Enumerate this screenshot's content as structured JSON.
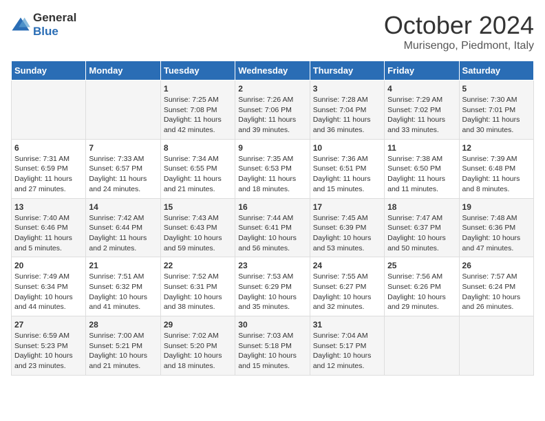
{
  "header": {
    "logo_general": "General",
    "logo_blue": "Blue",
    "title": "October 2024",
    "location": "Murisengo, Piedmont, Italy"
  },
  "days_of_week": [
    "Sunday",
    "Monday",
    "Tuesday",
    "Wednesday",
    "Thursday",
    "Friday",
    "Saturday"
  ],
  "weeks": [
    [
      {
        "day": "",
        "content": ""
      },
      {
        "day": "",
        "content": ""
      },
      {
        "day": "1",
        "content": "Sunrise: 7:25 AM\nSunset: 7:08 PM\nDaylight: 11 hours and 42 minutes."
      },
      {
        "day": "2",
        "content": "Sunrise: 7:26 AM\nSunset: 7:06 PM\nDaylight: 11 hours and 39 minutes."
      },
      {
        "day": "3",
        "content": "Sunrise: 7:28 AM\nSunset: 7:04 PM\nDaylight: 11 hours and 36 minutes."
      },
      {
        "day": "4",
        "content": "Sunrise: 7:29 AM\nSunset: 7:02 PM\nDaylight: 11 hours and 33 minutes."
      },
      {
        "day": "5",
        "content": "Sunrise: 7:30 AM\nSunset: 7:01 PM\nDaylight: 11 hours and 30 minutes."
      }
    ],
    [
      {
        "day": "6",
        "content": "Sunrise: 7:31 AM\nSunset: 6:59 PM\nDaylight: 11 hours and 27 minutes."
      },
      {
        "day": "7",
        "content": "Sunrise: 7:33 AM\nSunset: 6:57 PM\nDaylight: 11 hours and 24 minutes."
      },
      {
        "day": "8",
        "content": "Sunrise: 7:34 AM\nSunset: 6:55 PM\nDaylight: 11 hours and 21 minutes."
      },
      {
        "day": "9",
        "content": "Sunrise: 7:35 AM\nSunset: 6:53 PM\nDaylight: 11 hours and 18 minutes."
      },
      {
        "day": "10",
        "content": "Sunrise: 7:36 AM\nSunset: 6:51 PM\nDaylight: 11 hours and 15 minutes."
      },
      {
        "day": "11",
        "content": "Sunrise: 7:38 AM\nSunset: 6:50 PM\nDaylight: 11 hours and 11 minutes."
      },
      {
        "day": "12",
        "content": "Sunrise: 7:39 AM\nSunset: 6:48 PM\nDaylight: 11 hours and 8 minutes."
      }
    ],
    [
      {
        "day": "13",
        "content": "Sunrise: 7:40 AM\nSunset: 6:46 PM\nDaylight: 11 hours and 5 minutes."
      },
      {
        "day": "14",
        "content": "Sunrise: 7:42 AM\nSunset: 6:44 PM\nDaylight: 11 hours and 2 minutes."
      },
      {
        "day": "15",
        "content": "Sunrise: 7:43 AM\nSunset: 6:43 PM\nDaylight: 10 hours and 59 minutes."
      },
      {
        "day": "16",
        "content": "Sunrise: 7:44 AM\nSunset: 6:41 PM\nDaylight: 10 hours and 56 minutes."
      },
      {
        "day": "17",
        "content": "Sunrise: 7:45 AM\nSunset: 6:39 PM\nDaylight: 10 hours and 53 minutes."
      },
      {
        "day": "18",
        "content": "Sunrise: 7:47 AM\nSunset: 6:37 PM\nDaylight: 10 hours and 50 minutes."
      },
      {
        "day": "19",
        "content": "Sunrise: 7:48 AM\nSunset: 6:36 PM\nDaylight: 10 hours and 47 minutes."
      }
    ],
    [
      {
        "day": "20",
        "content": "Sunrise: 7:49 AM\nSunset: 6:34 PM\nDaylight: 10 hours and 44 minutes."
      },
      {
        "day": "21",
        "content": "Sunrise: 7:51 AM\nSunset: 6:32 PM\nDaylight: 10 hours and 41 minutes."
      },
      {
        "day": "22",
        "content": "Sunrise: 7:52 AM\nSunset: 6:31 PM\nDaylight: 10 hours and 38 minutes."
      },
      {
        "day": "23",
        "content": "Sunrise: 7:53 AM\nSunset: 6:29 PM\nDaylight: 10 hours and 35 minutes."
      },
      {
        "day": "24",
        "content": "Sunrise: 7:55 AM\nSunset: 6:27 PM\nDaylight: 10 hours and 32 minutes."
      },
      {
        "day": "25",
        "content": "Sunrise: 7:56 AM\nSunset: 6:26 PM\nDaylight: 10 hours and 29 minutes."
      },
      {
        "day": "26",
        "content": "Sunrise: 7:57 AM\nSunset: 6:24 PM\nDaylight: 10 hours and 26 minutes."
      }
    ],
    [
      {
        "day": "27",
        "content": "Sunrise: 6:59 AM\nSunset: 5:23 PM\nDaylight: 10 hours and 23 minutes."
      },
      {
        "day": "28",
        "content": "Sunrise: 7:00 AM\nSunset: 5:21 PM\nDaylight: 10 hours and 21 minutes."
      },
      {
        "day": "29",
        "content": "Sunrise: 7:02 AM\nSunset: 5:20 PM\nDaylight: 10 hours and 18 minutes."
      },
      {
        "day": "30",
        "content": "Sunrise: 7:03 AM\nSunset: 5:18 PM\nDaylight: 10 hours and 15 minutes."
      },
      {
        "day": "31",
        "content": "Sunrise: 7:04 AM\nSunset: 5:17 PM\nDaylight: 10 hours and 12 minutes."
      },
      {
        "day": "",
        "content": ""
      },
      {
        "day": "",
        "content": ""
      }
    ]
  ]
}
